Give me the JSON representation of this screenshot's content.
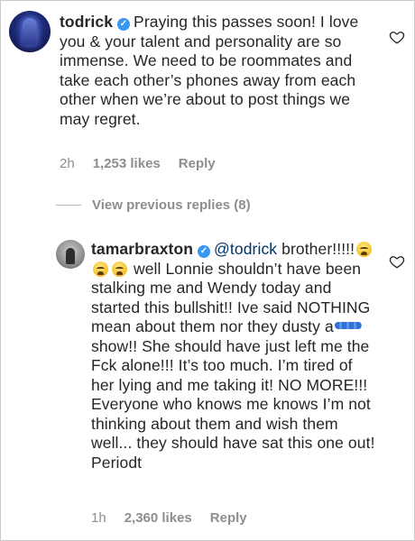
{
  "comments": [
    {
      "username": "todrick",
      "text": "Praying this passes soon! I love you & your talent and personality are so immense. We need to be roommates and take each other’s phones away from each other when we’re about to post things we may regret.",
      "time": "2h",
      "likes": "1,253 likes",
      "reply": "Reply"
    },
    {
      "username": "tamarbraxton",
      "mention": "@todrick",
      "text_part1": "brother!!!!!",
      "text_part2": "well Lonnie shouldn’t have been stalking me and Wendy today and started this bullshit!! Ive said NOTHING mean about them nor they dusty a",
      "text_part3": "show!! She should have just left me the Fck alone!!! It’s too much. I’m tired of her lying and me taking it! NO MORE!!! Everyone who knows me knows I’m not thinking about them and wish them well... they should have sat this one out! Periodt",
      "time": "1h",
      "likes": "2,360 likes",
      "reply": "Reply"
    }
  ],
  "view_replies": "View previous replies (8)",
  "icons": {
    "verified": "verified-badge-icon",
    "like": "heart-outline-icon",
    "emoji": "weary-face-emoji",
    "redaction": "scribble-redaction-mark"
  },
  "colors": {
    "verified": "#3897f0",
    "meta": "#8e8e8e",
    "mention": "#003569"
  }
}
